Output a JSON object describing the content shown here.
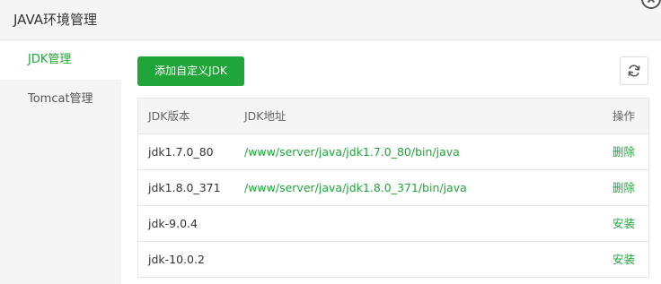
{
  "window": {
    "title": "JAVA环境管理"
  },
  "sidebar": {
    "items": [
      {
        "label": "JDK管理",
        "active": true
      },
      {
        "label": "Tomcat管理",
        "active": false
      }
    ]
  },
  "toolbar": {
    "add_label": "添加自定义JDK",
    "refresh_icon": "refresh-icon"
  },
  "table": {
    "headers": {
      "version": "JDK版本",
      "path": "JDK地址",
      "action": "操作"
    },
    "rows": [
      {
        "version": "jdk1.7.0_80",
        "path": "/www/server/java/jdk1.7.0_80/bin/java",
        "action": "删除"
      },
      {
        "version": "jdk1.8.0_371",
        "path": "/www/server/java/jdk1.8.0_371/bin/java",
        "action": "删除"
      },
      {
        "version": "jdk-9.0.4",
        "path": "",
        "action": "安装"
      },
      {
        "version": "jdk-10.0.2",
        "path": "",
        "action": "安装"
      }
    ]
  },
  "colors": {
    "accent": "#20a53a",
    "sidebar_bg": "#f5f5f5",
    "border": "#e6e6e6"
  }
}
